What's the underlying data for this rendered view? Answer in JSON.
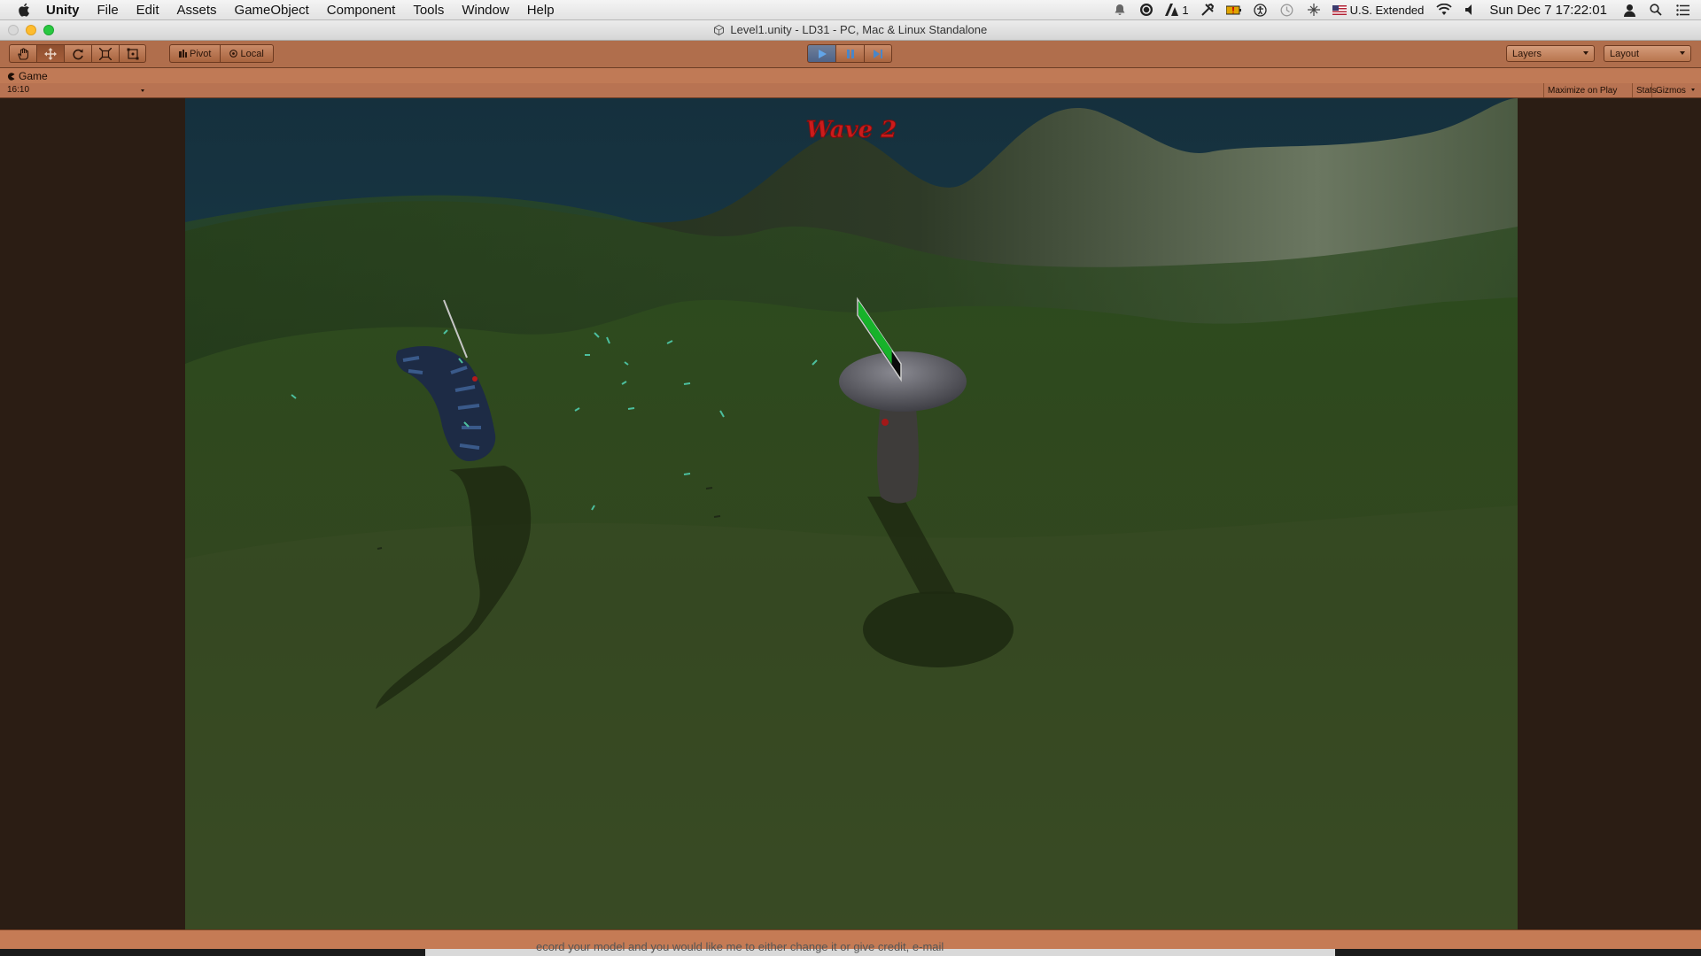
{
  "menubar": {
    "app_name": "Unity",
    "items": [
      "File",
      "Edit",
      "Assets",
      "GameObject",
      "Component",
      "Tools",
      "Window",
      "Help"
    ],
    "input_source": "U.S. Extended",
    "clock": "Sun Dec 7  17:22:01",
    "notification_count": "1"
  },
  "window": {
    "title": "Level1.unity - LD31 - PC, Mac & Linux Standalone"
  },
  "toolbar": {
    "pivot_label": "Pivot",
    "local_label": "Local",
    "layers_label": "Layers",
    "layout_label": "Layout",
    "play_state": "playing",
    "accent_color": "#b06e4c"
  },
  "game_view": {
    "tab_label": "Game",
    "aspect": "16:10",
    "maximize_label": "Maximize on Play",
    "stats_label": "Stats",
    "gizmos_label": "Gizmos",
    "hud_text": "Wave 2",
    "hud_color": "#cc1b1b",
    "health_bar_fill": 0.8
  },
  "desktop": {
    "partial_text": "ecord your model and you would like me to either change it or give credit, e-mail"
  }
}
